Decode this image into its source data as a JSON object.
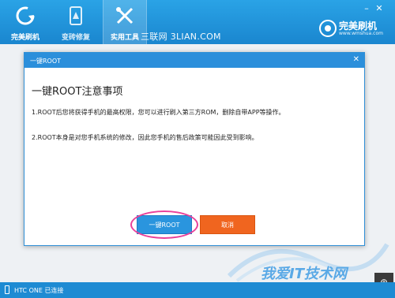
{
  "toolbar": {
    "tabs": [
      {
        "label": "完美刷机",
        "icon": "refresh-icon"
      },
      {
        "label": "变砖修复",
        "icon": "phone-repair-icon"
      },
      {
        "label": "实用工具",
        "icon": "tools-icon"
      }
    ],
    "watermark": "三联网 3LIAN.COM"
  },
  "brand": {
    "name": "完美刷机",
    "url": "www.wmshua.com"
  },
  "dialog": {
    "title": "一键ROOT",
    "heading": "一键ROOT注意事项",
    "paragraph1": "1.ROOT后您将获得手机的最高权限，您可以进行刷入第三方ROM，删除自带APP等操作。",
    "paragraph2": "2.ROOT本身是对您手机系统的修改，因此您手机的售后政策可能因此受到影响。",
    "root_button": "一键ROOT",
    "cancel_button": "取消"
  },
  "status": {
    "device": "HTC ONE 已连接"
  },
  "footer_watermark": "我爱IT技术网",
  "colors": {
    "accent": "#2b8fdb",
    "cancel": "#f0651f",
    "highlight": "#e9419a"
  }
}
